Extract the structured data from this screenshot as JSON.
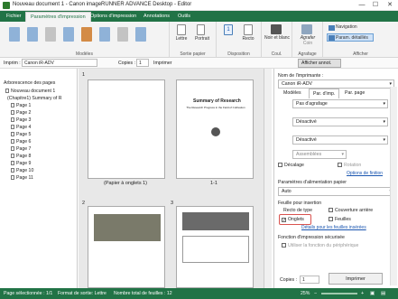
{
  "window": {
    "title": "Nouveau document 1 - Canon imageRUNNER ADVANCE Desktop - Editor",
    "minimize": "—",
    "maximize": "☐",
    "close": "✕"
  },
  "tabs": [
    {
      "label": "Fichier"
    },
    {
      "label": "Paramètres d'impression"
    },
    {
      "label": "Options d'impression"
    },
    {
      "label": "Annotations"
    },
    {
      "label": "Outils"
    }
  ],
  "ribbon": {
    "modeles_group": "Modèles",
    "sortie_group": "Sortie papier",
    "disposition_group": "Disposition",
    "coul_group": "Coul.",
    "agrafage_group": "Agrafage",
    "afficher_group": "Afficher",
    "lettre": "Lettre",
    "portrait": "Portrait",
    "one": "1",
    "recto": "Recto",
    "noir_blanc": "Noir et blanc",
    "agrafer": "Agrafer",
    "coin": "Coin",
    "navigation": "Navigation",
    "param_details": "Param. détaillés"
  },
  "toolbar": {
    "imprim_label": "Imprim :",
    "printer": "Canon iR-ADV",
    "copies_label": "Copies :",
    "copies": "1",
    "imprimer": "Imprimer",
    "afficher_annot": "Afficher annot."
  },
  "left": {
    "tree_title": "Arborescence des pages",
    "items": [
      "Nouveau document 1",
      "(Chapitre1) Summary of R",
      "Page 1",
      "Page 2",
      "Page 3",
      "Page 4",
      "Page 5",
      "Page 6",
      "Page 7",
      "Page 8",
      "Page 9",
      "Page 10",
      "Page 11"
    ]
  },
  "preview": {
    "p1_caption": "(Papier à onglets 1)",
    "p2_caption": "1-1",
    "num_top": "1",
    "num_2": "2",
    "num_3": "3",
    "doc_title": "Summary of Research",
    "doc_sub": "The Research Progress in the Field of Cultivation"
  },
  "right": {
    "printer_label": "Nom de l'imprimante :",
    "printer": "Canon iR-ADV",
    "tabs": [
      "Modèles",
      "Par. d'imp.",
      "Par. page"
    ],
    "agrafage": "Pas d'agrafage",
    "desactive1": "Désactivé",
    "desactive2": "Désactivé",
    "assemblies": "Assemblées",
    "decalage": "Décalage",
    "rotation": "Rotation",
    "options_finition": "Options de finition",
    "alim_label": "Paramètres d'alimentation papier",
    "auto": "Auto",
    "feuille_label": "Feuille pour insertion",
    "recto_label": "Recto de type",
    "couverture": "Couverture arrière",
    "onglets": "Onglets",
    "feuilles": "Feuilles",
    "details_link": "Détails pour les feuilles insérées",
    "securite_label": "Fonction d'impression sécurisée",
    "utiliser": "Utiliser la fonction du périphérique",
    "copies_label": "Copies :",
    "copies": "1",
    "imprimer": "Imprimer"
  },
  "status": {
    "page_sel": "Page sélectionnée : 1/1",
    "format": "Format de sortie: Lettre",
    "total": "Nombre total de feuilles : 12",
    "zoom": "25%"
  },
  "colors": {
    "accent": "#217346",
    "highlight": "#d9534f"
  }
}
